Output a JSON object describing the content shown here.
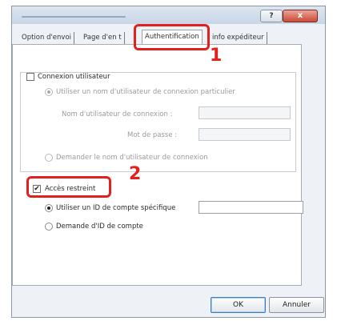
{
  "window": {
    "help_label": "?",
    "close_label": "x"
  },
  "tabs": [
    {
      "label": "Option d'envoi"
    },
    {
      "label": "Page d'en t"
    },
    {
      "label": "Authentification"
    },
    {
      "label": "info expéditeur"
    }
  ],
  "auth": {
    "user_login_label": "Connexion utilisateur",
    "use_specific_name_label": "Utiliser un nom d'utilisateur de connexion particulier",
    "username_label": "Nom d'utilisateur de connexion :",
    "password_label": "Mot de passe :",
    "ask_name_label": "Demander le nom d'utilisateur de connexion",
    "restricted_access_label": "Accès restreint",
    "use_account_id_label": "Utiliser un ID de compte spécifique",
    "ask_account_id_label": "Demande d'ID de compte",
    "account_id_value": ""
  },
  "callouts": {
    "one": "1",
    "two": "2"
  },
  "buttons": {
    "ok": "OK",
    "cancel": "Annuler"
  }
}
